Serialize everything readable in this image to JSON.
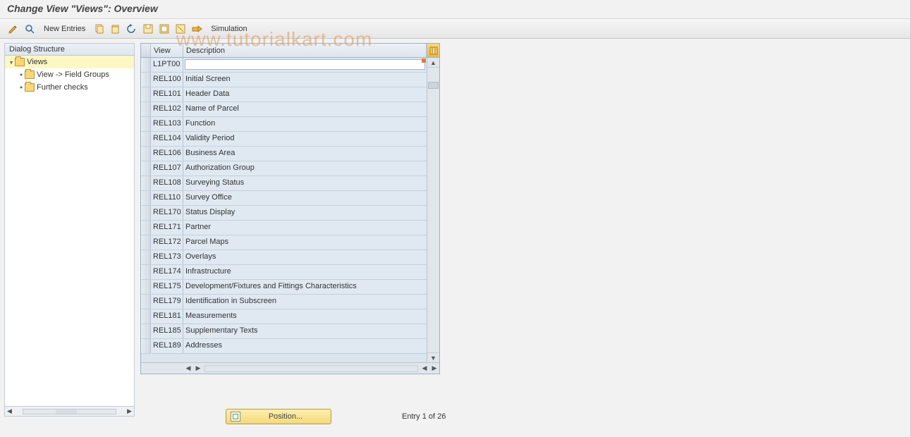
{
  "title": "Change View \"Views\": Overview",
  "watermark": "www.tutorialkart.com",
  "toolbar": {
    "new_entries": "New Entries",
    "simulation": "Simulation"
  },
  "tree": {
    "header": "Dialog Structure",
    "items": [
      {
        "label": "Views",
        "level": 0,
        "open": true,
        "selected": true,
        "toggle": "▾"
      },
      {
        "label": "View -> Field Groups",
        "level": 1,
        "open": false,
        "selected": false,
        "toggle": "•"
      },
      {
        "label": "Further checks",
        "level": 1,
        "open": false,
        "selected": false,
        "toggle": "•"
      }
    ]
  },
  "table": {
    "col_view": "View",
    "col_desc": "Description",
    "rows": [
      {
        "view": "L1PT00",
        "desc": ""
      },
      {
        "view": "REL100",
        "desc": "Initial Screen"
      },
      {
        "view": "REL101",
        "desc": "Header Data"
      },
      {
        "view": "REL102",
        "desc": "Name of Parcel"
      },
      {
        "view": "REL103",
        "desc": "Function"
      },
      {
        "view": "REL104",
        "desc": "Validity Period"
      },
      {
        "view": "REL106",
        "desc": "Business Area"
      },
      {
        "view": "REL107",
        "desc": "Authorization Group"
      },
      {
        "view": "REL108",
        "desc": "Surveying Status"
      },
      {
        "view": "REL110",
        "desc": "Survey Office"
      },
      {
        "view": "REL170",
        "desc": "Status Display"
      },
      {
        "view": "REL171",
        "desc": "Partner"
      },
      {
        "view": "REL172",
        "desc": "Parcel Maps"
      },
      {
        "view": "REL173",
        "desc": "Overlays"
      },
      {
        "view": "REL174",
        "desc": "Infrastructure"
      },
      {
        "view": "REL175",
        "desc": "Development/Fixtures and Fittings Characteristics"
      },
      {
        "view": "REL179",
        "desc": "Identification in Subscreen"
      },
      {
        "view": "REL181",
        "desc": "Measurements"
      },
      {
        "view": "REL185",
        "desc": "Supplementary Texts"
      },
      {
        "view": "REL189",
        "desc": "Addresses"
      }
    ]
  },
  "footer": {
    "position": "Position...",
    "entry_count": "Entry 1 of 26"
  }
}
